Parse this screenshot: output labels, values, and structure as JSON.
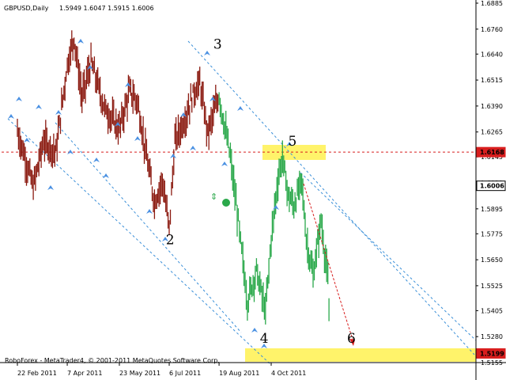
{
  "header": {
    "symbol": "GBPUSD,Daily",
    "quote": "1.5949 1.6047 1.5915 1.6006"
  },
  "footer": {
    "credit": "RoboForex - MetaTrader4, © 2001-2011 MetaQuotes Software Corp."
  },
  "colors": {
    "background": "#ffffff",
    "bull_bar": "#2aa84a",
    "bear_bar": "#8b1a10",
    "channel_line": "#3a8fd8",
    "fractal_arrow": "#4a90e2",
    "resistance_line": "#d81e1e",
    "highlight_zone": "#fff36a",
    "current_price_box": "#000000",
    "level_box": "#d81e1e"
  },
  "chart_data": {
    "type": "line",
    "title": "",
    "xlabel": "",
    "ylabel": "",
    "ylim": [
      1.5155,
      1.6885
    ],
    "grid": false,
    "y_ticks": [
      "1.6885",
      "1.6760",
      "1.6640",
      "1.6515",
      "1.6390",
      "1.6265",
      "1.6145",
      "1.6020",
      "1.5895",
      "1.5775",
      "1.5650",
      "1.5525",
      "1.5405",
      "1.5280",
      "1.5155"
    ],
    "x_ticks": [
      "22 Feb 2011",
      "7 Apr 2011",
      "23 May 2011",
      "6 Jul 2011",
      "19 Aug 2011",
      "4 Oct 2011"
    ],
    "series": [
      {
        "x": [
          "2011-02-22",
          "2011-03-08",
          "2011-03-17",
          "2011-03-28",
          "2011-04-07",
          "2011-04-13",
          "2011-04-20",
          "2011-04-28",
          "2011-05-10",
          "2011-05-23",
          "2011-06-01",
          "2011-06-08",
          "2011-06-17",
          "2011-06-23",
          "2011-06-30",
          "2011-07-06",
          "2011-07-11",
          "2011-07-20",
          "2011-07-28",
          "2011-08-02",
          "2011-08-09",
          "2011-08-19",
          "2011-08-29",
          "2011-09-05",
          "2011-09-13",
          "2011-09-21",
          "2011-09-29",
          "2011-10-04",
          "2011-10-10",
          "2011-10-14",
          "2011-10-19",
          "2011-10-24",
          "2011-10-31",
          "2011-11-04",
          "2011-11-10",
          "2011-11-17",
          "2011-11-23",
          "2011-11-25"
        ],
        "values": [
          1.627,
          1.6,
          1.622,
          1.617,
          1.659,
          1.672,
          1.643,
          1.66,
          1.638,
          1.628,
          1.646,
          1.641,
          1.611,
          1.593,
          1.603,
          1.58,
          1.622,
          1.633,
          1.646,
          1.65,
          1.626,
          1.644,
          1.614,
          1.583,
          1.545,
          1.56,
          1.54,
          1.575,
          1.604,
          1.614,
          1.596,
          1.591,
          1.603,
          1.575,
          1.557,
          1.584,
          1.555,
          1.52
        ]
      }
    ],
    "price_levels": [
      {
        "value": 1.6168,
        "label": "1.6168",
        "kind": "resistance"
      },
      {
        "value": 1.6006,
        "label": "1.6006",
        "kind": "current"
      },
      {
        "value": 1.5199,
        "label": "1.5199",
        "kind": "target"
      }
    ],
    "wave_labels": [
      {
        "text": "2",
        "x": "2011-07-03",
        "y": 1.5725
      },
      {
        "text": "3",
        "x": "2011-08-14",
        "y": 1.6665
      },
      {
        "text": "4",
        "x": "2011-09-24",
        "y": 1.525
      },
      {
        "text": "5",
        "x": "2011-10-19",
        "y": 1.62
      },
      {
        "text": "6",
        "x": "2011-12-10",
        "y": 1.525
      }
    ]
  }
}
